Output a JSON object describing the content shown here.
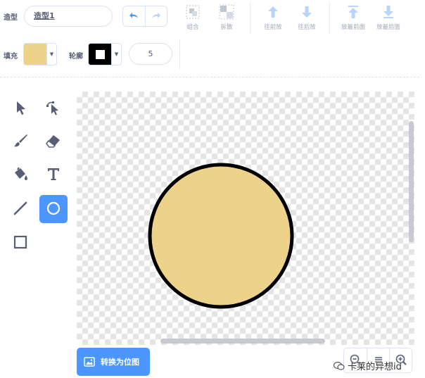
{
  "toolbar": {
    "costume_label": "造型",
    "costume_name": "造型1",
    "undo_icon": "undo-icon",
    "redo_icon": "redo-icon",
    "group_label": "组合",
    "ungroup_label": "拆散",
    "forward_label": "往前放",
    "backward_label": "往后放",
    "front_label": "放最前面",
    "back_label": "放最后面"
  },
  "style_bar": {
    "fill_label": "填充",
    "fill_color": "#edd28a",
    "outline_label": "轮廓",
    "outline_color": "#000000",
    "outline_width": "5"
  },
  "tools": [
    {
      "name": "select",
      "icon": "select-arrow-icon",
      "active": false
    },
    {
      "name": "reshape",
      "icon": "reshape-icon",
      "active": false
    },
    {
      "name": "brush",
      "icon": "brush-icon",
      "active": false
    },
    {
      "name": "eraser",
      "icon": "eraser-icon",
      "active": false
    },
    {
      "name": "fill",
      "icon": "paint-bucket-icon",
      "active": false
    },
    {
      "name": "text",
      "icon": "text-icon",
      "active": false
    },
    {
      "name": "line",
      "icon": "line-icon",
      "active": false
    },
    {
      "name": "circle",
      "icon": "circle-icon",
      "active": true
    },
    {
      "name": "rectangle",
      "icon": "rectangle-icon",
      "active": false
    }
  ],
  "canvas": {
    "shape": "circle",
    "fill_color": "#edd28a",
    "stroke_color": "#000000"
  },
  "bottom": {
    "convert_label": "转换为位图",
    "zoom_out_icon": "zoom-out-icon",
    "zoom_reset_icon": "zoom-reset-icon",
    "zoom_in_icon": "zoom-in-icon"
  },
  "watermark": {
    "text": "卡莱的异想id"
  },
  "colors": {
    "accent": "#4c97ff",
    "text": "#575e75",
    "disabled": "#a2a9b9"
  }
}
